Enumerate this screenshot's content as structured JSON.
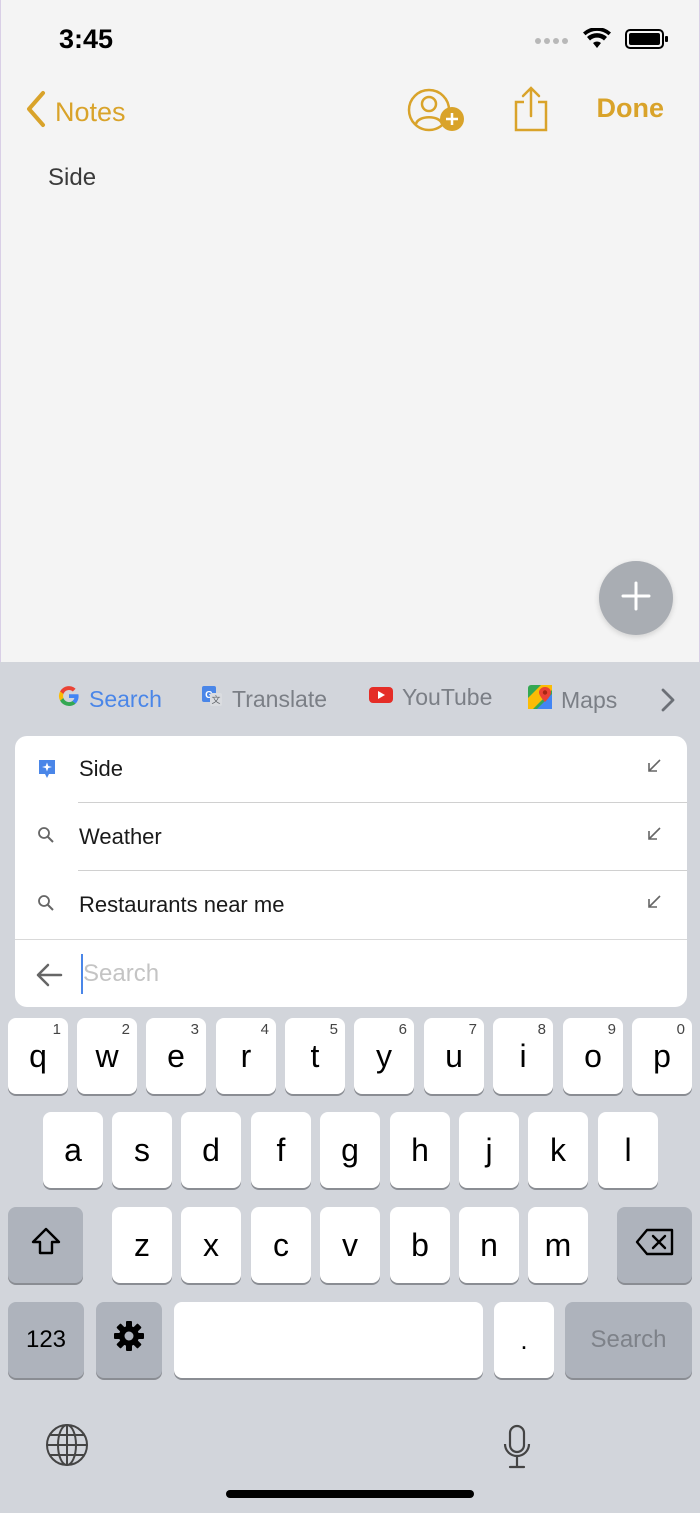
{
  "status_bar": {
    "time": "3:45"
  },
  "nav": {
    "back_label": "Notes",
    "done_label": "Done"
  },
  "note": {
    "text": "Side"
  },
  "shortcuts": [
    {
      "label": "Search",
      "icon": "google-g-icon",
      "active": true
    },
    {
      "label": "Translate",
      "icon": "google-translate-icon",
      "active": false
    },
    {
      "label": "YouTube",
      "icon": "youtube-icon",
      "active": false
    },
    {
      "label": "Maps",
      "icon": "google-maps-icon",
      "active": false
    }
  ],
  "suggestions": [
    {
      "label": "Side",
      "icon": "clipboard-sparkle-icon"
    },
    {
      "label": "Weather",
      "icon": "search-icon"
    },
    {
      "label": "Restaurants near me",
      "icon": "search-icon"
    }
  ],
  "search": {
    "placeholder": "Search",
    "value": ""
  },
  "keyboard": {
    "row1": [
      {
        "key": "q",
        "num": "1"
      },
      {
        "key": "w",
        "num": "2"
      },
      {
        "key": "e",
        "num": "3"
      },
      {
        "key": "r",
        "num": "4"
      },
      {
        "key": "t",
        "num": "5"
      },
      {
        "key": "y",
        "num": "6"
      },
      {
        "key": "u",
        "num": "7"
      },
      {
        "key": "i",
        "num": "8"
      },
      {
        "key": "o",
        "num": "9"
      },
      {
        "key": "p",
        "num": "0"
      }
    ],
    "row2": [
      "a",
      "s",
      "d",
      "f",
      "g",
      "h",
      "j",
      "k",
      "l"
    ],
    "row3": [
      "z",
      "x",
      "c",
      "v",
      "b",
      "n",
      "m"
    ],
    "numbers_label": "123",
    "period_label": ".",
    "search_label": "Search"
  },
  "colors": {
    "accent": "#d9a32a",
    "google_blue": "#4a86e8",
    "keyboard_bg": "#d2d5db",
    "fab": "#a9adb3"
  }
}
